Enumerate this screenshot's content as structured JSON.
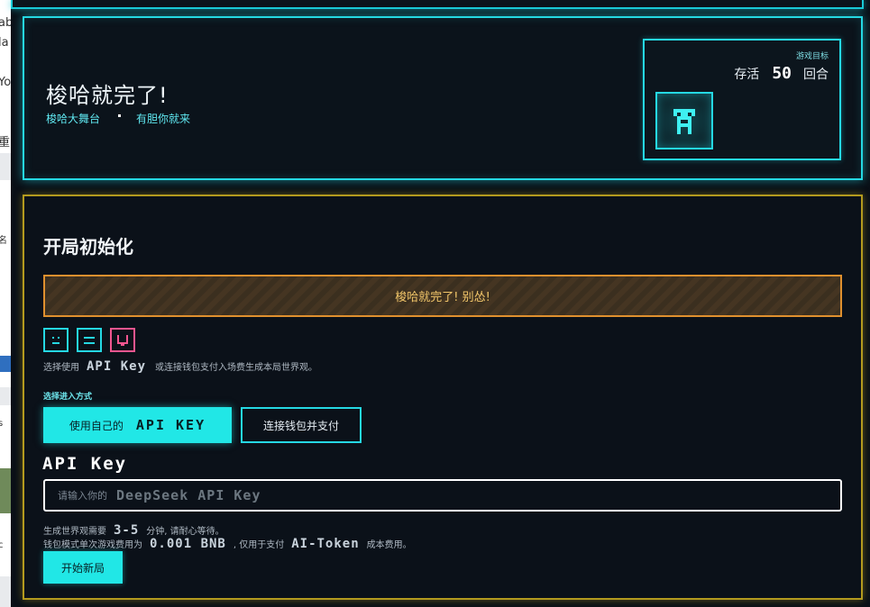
{
  "background_window": {
    "fragments": [
      "ab",
      "la",
      "Yo",
      "重",
      "名",
      "s",
      "c"
    ]
  },
  "hero": {
    "title": "梭哈就完了!",
    "tag_left": "梭哈大舞台",
    "tag_right": "有胆你就来",
    "goal": {
      "label": "游戏目标",
      "prefix": "存活",
      "number": "50",
      "suffix": "回合"
    }
  },
  "panel": {
    "title": "开局初始化",
    "warning": "梭哈就完了! 别怂!",
    "hint_prefix": "选择使用",
    "hint_key": "API Key",
    "hint_suffix": "或连接钱包支付入场费生成本局世界观。",
    "mode_label": "选择进入方式",
    "mode_api_prefix": "使用自己的",
    "mode_api_key": "API KEY",
    "mode_wallet": "连接钱包并支付",
    "api_heading": "API Key",
    "api_placeholder_prefix": "请输入你的",
    "api_placeholder_key": "DeepSeek API Key",
    "note1_prefix": "生成世界观需要",
    "note1_value": "3-5",
    "note1_suffix": "分钟, 请耐心等待。",
    "note2_prefix": "钱包模式单次游戏费用为",
    "note2_value": "0.001 BNB",
    "note2_middle": ", 仅用于支付",
    "note2_token": "AI-Token",
    "note2_suffix": "成本费用。",
    "start_button": "开始新局"
  },
  "colors": {
    "cyan": "#25d8e3",
    "gold": "#b39a1e",
    "orange": "#e0902e",
    "pink": "#f0568f",
    "button": "#21e7e6"
  },
  "icons": [
    "pixel-robot-icon",
    "face-neutral-icon",
    "face-flat-icon",
    "face-smile-icon"
  ]
}
